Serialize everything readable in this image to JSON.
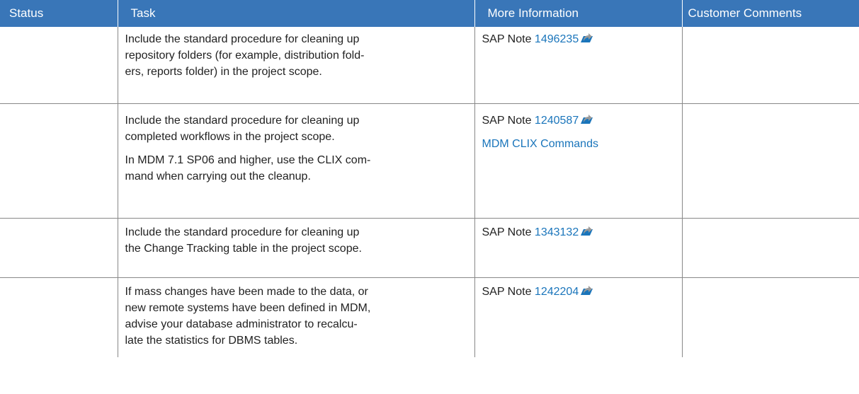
{
  "table": {
    "headers": [
      "Status",
      "Task",
      "More Information",
      "Customer Comments"
    ],
    "rows": [
      {
        "task": [
          "Include the standard procedure for cleaning up\nrepository folders (for example, distribution fold-\ners, reports folder) in the project scope."
        ],
        "info_prefix": "SAP Note ",
        "note_number": "1496235",
        "extra_link": ""
      },
      {
        "task": [
          "Include the standard procedure for cleaning up\ncompleted workflows in the project scope.",
          "In MDM 7.1 SP06 and higher, use the CLIX com-\nmand when carrying out the cleanup."
        ],
        "info_prefix": "SAP Note ",
        "note_number": "1240587",
        "extra_link": "MDM CLIX Commands"
      },
      {
        "task": [
          "Include the standard procedure for cleaning up\nthe Change Tracking table in the project scope."
        ],
        "info_prefix": "SAP Note ",
        "note_number": "1343132",
        "extra_link": ""
      },
      {
        "task": [
          "If mass changes have been made to the data, or\nnew remote systems have been defined in MDM,\nadvise your database administrator to recalcu-\nlate the statistics for DBMS tables."
        ],
        "info_prefix": "SAP Note ",
        "note_number": "1242204",
        "extra_link": ""
      }
    ]
  },
  "icons": {
    "external_link": "external-link-arrow-icon"
  },
  "colors": {
    "header_bg": "#3976b8",
    "header_text": "#ffffff",
    "link": "#1a75bb",
    "border": "#888888"
  }
}
